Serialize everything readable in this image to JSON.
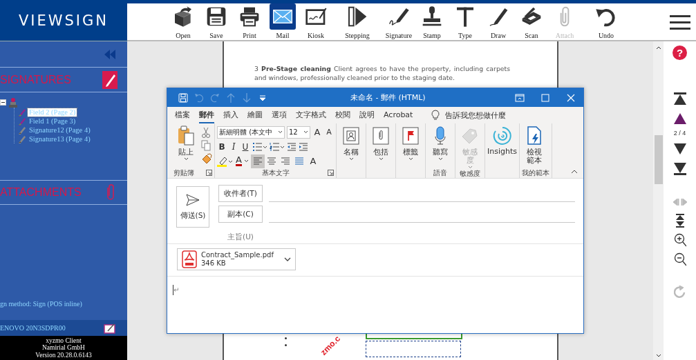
{
  "logo": "VIEWSIGN",
  "sidebar": {
    "signatures": {
      "title": "SIGNATURES",
      "expanded": true,
      "items": [
        {
          "label": "Field 2 (Page 2)",
          "kind": "field",
          "selected": true
        },
        {
          "label": "Field 1 (Page 3)",
          "kind": "field",
          "selected": false
        },
        {
          "label": "Signature12 (Page 4)",
          "kind": "signature",
          "selected": false
        },
        {
          "label": "Signature13 (Page 4)",
          "kind": "signature",
          "selected": false
        }
      ]
    },
    "attachments": {
      "title": "ATTACHMENTS"
    },
    "sign_method": "gn method: Sign (POS inline)",
    "device": "ENOVO 20N3SDPR00",
    "footer": [
      "xyzmo Client",
      "Namirial GmbH",
      "Version 20.28.0.6143"
    ]
  },
  "toolbar": [
    {
      "label": "Open",
      "kind": "open",
      "selected": false,
      "disabled": false
    },
    {
      "label": "Save",
      "kind": "save",
      "selected": false,
      "disabled": false
    },
    {
      "label": "Print",
      "kind": "print",
      "selected": false,
      "disabled": false
    },
    {
      "label": "Mail",
      "kind": "mail",
      "selected": true,
      "disabled": false
    },
    {
      "label": "Kiosk",
      "kind": "kiosk",
      "selected": false,
      "disabled": false
    },
    {
      "label": "Stepping",
      "kind": "stepping",
      "selected": false,
      "disabled": false
    },
    {
      "label": "Signature",
      "kind": "signature",
      "selected": false,
      "disabled": false
    },
    {
      "label": "Stamp",
      "kind": "stamp",
      "selected": false,
      "disabled": false
    },
    {
      "label": "Type",
      "kind": "type",
      "selected": false,
      "disabled": false
    },
    {
      "label": "Draw",
      "kind": "draw",
      "selected": false,
      "disabled": false
    },
    {
      "label": "Scan",
      "kind": "scan",
      "selected": false,
      "disabled": false
    },
    {
      "label": "Attach",
      "kind": "attach",
      "selected": false,
      "disabled": true
    },
    {
      "label": "Undo",
      "kind": "undo",
      "selected": false,
      "disabled": false
    }
  ],
  "document": {
    "paragraph": "3 **Pre-Stage cleaning** Client agrees to have the property, including carpets and windows, professionally cleaned prior to the staging date.",
    "stamp_text": "zmo.c"
  },
  "mail_window": {
    "title": "未命名 - 郵件 (HTML)",
    "quick_access": [
      {
        "kind": "save",
        "disabled": false
      },
      {
        "kind": "undo",
        "disabled": true
      },
      {
        "kind": "redo",
        "disabled": true
      },
      {
        "kind": "up",
        "disabled": true
      },
      {
        "kind": "down",
        "disabled": true
      },
      {
        "kind": "customize",
        "disabled": false
      }
    ],
    "window_controls": [
      {
        "kind": "ribbon_options"
      },
      {
        "kind": "maximize"
      },
      {
        "kind": "close"
      }
    ],
    "tabs": [
      {
        "label": "檔案",
        "selected": false
      },
      {
        "label": "郵件",
        "selected": true
      },
      {
        "label": "插入",
        "selected": false
      },
      {
        "label": "繪圖",
        "selected": false
      },
      {
        "label": "選項",
        "selected": false
      },
      {
        "label": "文字格式",
        "selected": false
      },
      {
        "label": "校閱",
        "selected": false
      },
      {
        "label": "說明",
        "selected": false
      },
      {
        "label": "Acrobat",
        "selected": false
      }
    ],
    "tell_me": "告訴我您想做什麼",
    "ribbon": [
      {
        "kind": "clipboard",
        "label": "剪貼簿",
        "paste": "貼上"
      },
      {
        "kind": "basic_text",
        "label": "基本文字",
        "font": "新細明體 (本文中",
        "size": "12",
        "grow": "A",
        "shrink": "A",
        "styles": [
          {
            "kind": "bold",
            "label": "B"
          },
          {
            "kind": "italic",
            "label": "I"
          },
          {
            "kind": "underline",
            "label": "U"
          }
        ],
        "font_color": "A",
        "clear": "A",
        "align": [
          {
            "kind": "left",
            "selected": true
          },
          {
            "kind": "center",
            "selected": false
          },
          {
            "kind": "right",
            "selected": false
          },
          {
            "kind": "distributed",
            "selected": false
          }
        ]
      },
      {
        "kind": "buttons",
        "buttons": [
          {
            "label": "名稱",
            "kind": "contact",
            "menu": true,
            "disabled": false
          }
        ]
      },
      {
        "kind": "buttons",
        "buttons": [
          {
            "label": "包括",
            "kind": "clip",
            "menu": true,
            "disabled": false
          }
        ]
      },
      {
        "kind": "buttons",
        "buttons": [
          {
            "label": "標籤",
            "kind": "flag",
            "menu": true,
            "disabled": false
          }
        ]
      },
      {
        "kind": "buttons",
        "label": "語音",
        "buttons": [
          {
            "label": "聽寫",
            "kind": "mic",
            "menu": true,
            "disabled": false
          }
        ]
      },
      {
        "kind": "buttons",
        "label": "敏感度",
        "buttons": [
          {
            "label": "敏感度",
            "kind": "tag",
            "menu": true,
            "disabled": true
          }
        ]
      },
      {
        "kind": "buttons",
        "buttons": [
          {
            "label": "Insights",
            "kind": "insights",
            "menu": false,
            "disabled": false
          }
        ]
      },
      {
        "kind": "buttons",
        "label": "我的範本",
        "buttons": [
          {
            "label": "檢視範本",
            "kind": "template",
            "menu": false,
            "disabled": false
          }
        ]
      }
    ],
    "compose": {
      "send": "傳送(S)",
      "to": "收件者(T)",
      "cc": "副本(C)",
      "subject": "主旨(U)",
      "attachment": {
        "name": "Contract_Sample.pdf",
        "size": "346 KB"
      },
      "body_mark": "↵"
    }
  },
  "navigation": {
    "help": "?",
    "page": "2 / 4",
    "buttons": [
      {
        "kind": "first",
        "highlighted": false,
        "disabled": false
      },
      {
        "kind": "prev",
        "highlighted": true,
        "disabled": false
      },
      {
        "kind": "page"
      },
      {
        "kind": "next",
        "highlighted": false,
        "disabled": false
      },
      {
        "kind": "last",
        "highlighted": false,
        "disabled": false
      },
      {
        "kind": "prevnext",
        "highlighted": false,
        "disabled": true
      },
      {
        "kind": "fit",
        "highlighted": false,
        "disabled": false
      },
      {
        "kind": "zoom_in",
        "highlighted": false,
        "disabled": false
      },
      {
        "kind": "zoom_out",
        "highlighted": false,
        "disabled": false
      },
      {
        "kind": "rotate",
        "highlighted": false,
        "disabled": true
      }
    ]
  }
}
